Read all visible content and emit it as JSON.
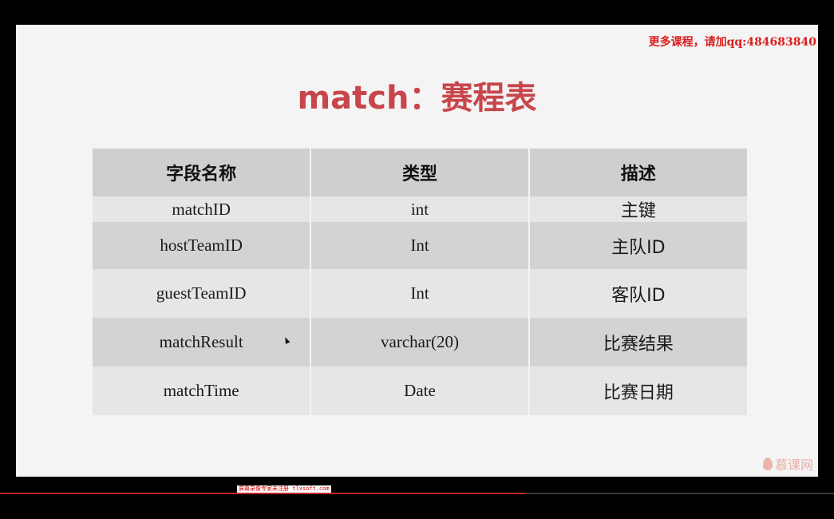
{
  "slide": {
    "watermark": "更多课程，请加qq:484683840",
    "title": "match：赛程表",
    "logo_text": "慕课网"
  },
  "table": {
    "headers": [
      "字段名称",
      "类型",
      "描述"
    ],
    "rows": [
      [
        "matchID",
        "int",
        "主键"
      ],
      [
        "hostTeamID",
        "Int",
        "主队ID"
      ],
      [
        "guestTeamID",
        "Int",
        "客队ID"
      ],
      [
        "matchResult",
        "varchar(20)",
        "比赛结果"
      ],
      [
        "matchTime",
        "Date",
        "比赛日期"
      ]
    ]
  },
  "player": {
    "progress_fraction": 0.63,
    "recorder_mark": "屏幕录像专家未注册 tlxsoft.com"
  },
  "colors": {
    "title": "#c8464b",
    "watermark": "#d92020",
    "header_bg": "#cfcfcf",
    "row_light": "#e6e6e6",
    "row_dark": "#d3d3d3",
    "progress": "#c0282d"
  },
  "icons": [
    "cursor-arrow-icon",
    "flame-logo-icon"
  ]
}
